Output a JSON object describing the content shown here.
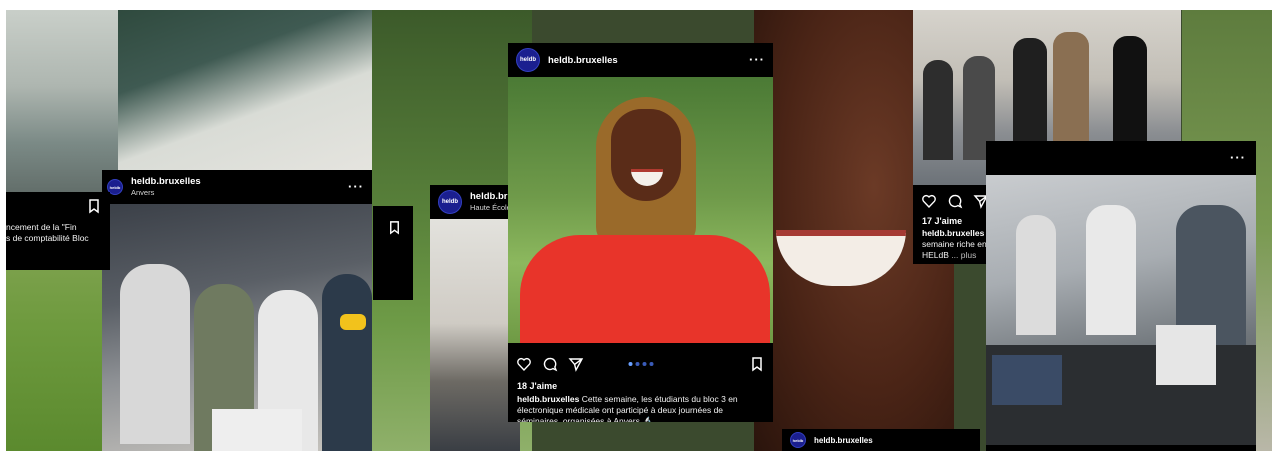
{
  "account": {
    "avatar_text": "heldb"
  },
  "posts": [
    {
      "username": "heldb.bruxelles",
      "location": "Anvers",
      "caption_fragment": "ncement de la \"Fin\ns de comptabilité Bloc"
    },
    {
      "username": "heldb.brux",
      "location": "Haute École"
    },
    {
      "username": "heldb.bruxelles",
      "likes": "18 J'aime",
      "caption_user": "heldb.bruxelles",
      "caption_text": "Cette semaine, les étudiants du bloc 3 en électronique médicale ont participé à deux journées de séminaires, organisées à Anvers 🔬"
    },
    {
      "likes": "17 J'aime",
      "caption_user": "heldb.bruxelles",
      "caption_text": "La semaine de prérentrée touche à sa fin ! Une semaine riche en apprentissages pour les futurs #étudiants de la HELdB",
      "caption_more": "... plus"
    },
    {
      "username": "heldb.bruxelles"
    }
  ],
  "icons": [
    "heart-icon",
    "comment-icon",
    "share-icon",
    "bookmark-icon",
    "more-icon"
  ],
  "colors": {
    "post_background": "#000000",
    "avatar": "#1b1f8f",
    "carousel_dot_active": "#6aa0ff",
    "carousel_dot": "#3a5bb8"
  }
}
